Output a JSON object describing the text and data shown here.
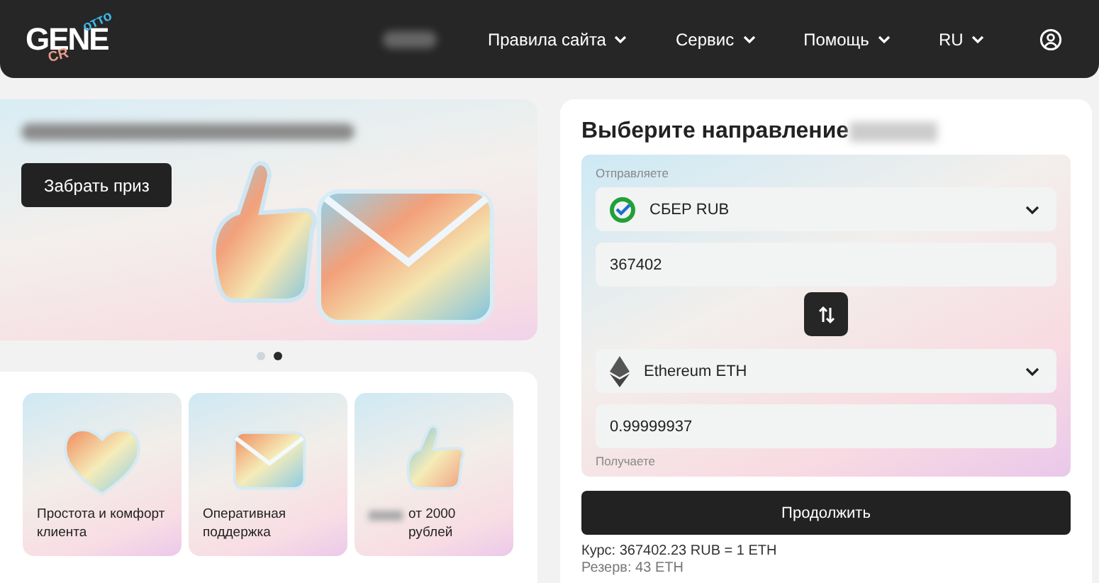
{
  "header": {
    "logo": {
      "main": "GENE",
      "accent_top": "отто",
      "accent_bottom": "CR"
    },
    "nav": [
      {
        "label": "Правила сайта"
      },
      {
        "label": "Сервис"
      },
      {
        "label": "Помощь"
      },
      {
        "label": "RU"
      }
    ]
  },
  "banner": {
    "button": "Забрать приз",
    "dots": [
      {
        "selected": false
      },
      {
        "selected": true
      }
    ]
  },
  "features": [
    {
      "kind": "heart",
      "text": "Простота и комфорт клиента",
      "blurred_prefix": false
    },
    {
      "kind": "envelope",
      "text": "Оперативная поддержка",
      "blurred_prefix": false
    },
    {
      "kind": "thumb",
      "text": "от 2000 рублей",
      "blurred_prefix": true
    }
  ],
  "exchange": {
    "title": "Выберите направление",
    "send_label": "Отправляете",
    "send_currency": {
      "kind": "sber",
      "name": "СБЕР RUB"
    },
    "send_amount": "367402",
    "receive_currency": {
      "kind": "eth",
      "name": "Ethereum ETH"
    },
    "receive_amount": "0.99999937",
    "receive_label": "Получаете",
    "button": "Продолжить",
    "rate": "Курс: 367402.23 RUB = 1 ETH",
    "reserve": "Резерв: 43 ETH"
  }
}
